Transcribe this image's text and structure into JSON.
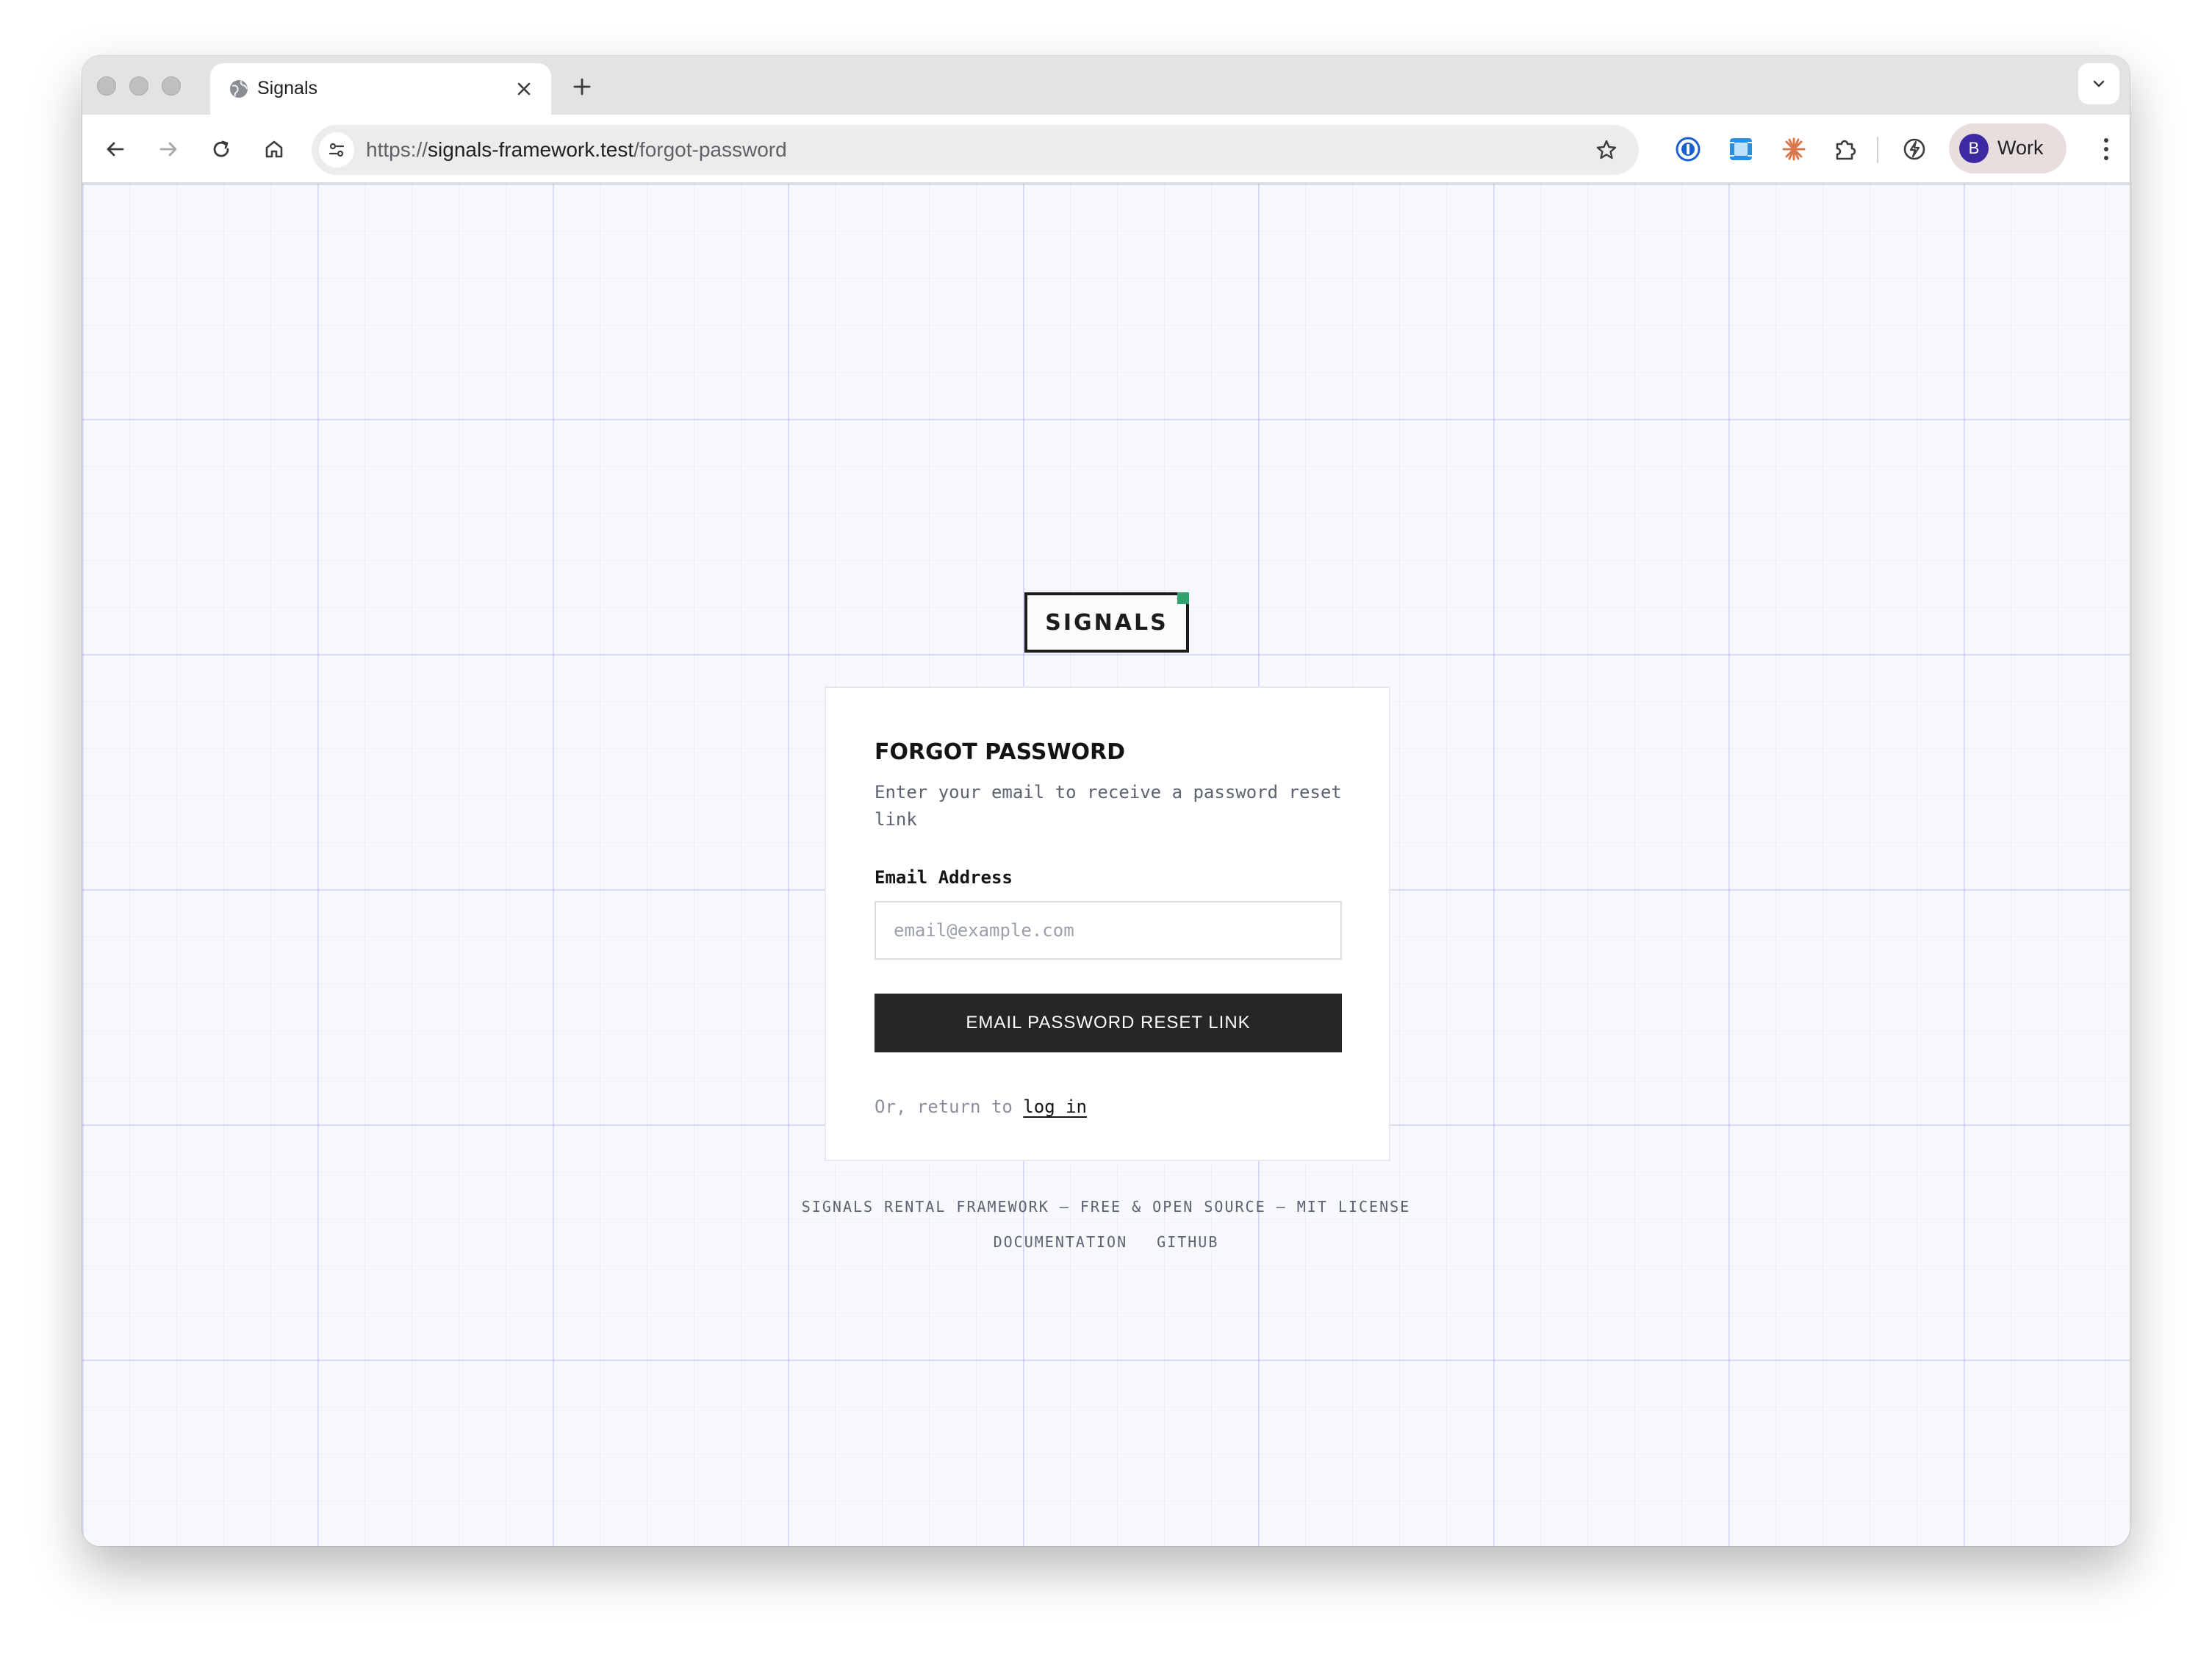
{
  "browser": {
    "tab_title": "Signals",
    "url_prefix": "https://",
    "url_host": "signals-framework.test",
    "url_path": "/forgot-password",
    "profile_initial": "B",
    "profile_name": "Work",
    "extensions": [
      "1password-icon",
      "frame-extension-icon",
      "claude-icon",
      "puzzle-icon"
    ],
    "accent_avatar": "#3d2aa3"
  },
  "page": {
    "logo_text": "SIGNALS",
    "logo_accent": "#2fa36b",
    "card": {
      "title": "FORGOT PASSWORD",
      "subtitle": "Enter your email to receive a password reset link",
      "email_label": "Email Address",
      "email_placeholder": "email@example.com",
      "email_value": "",
      "submit_label": "EMAIL PASSWORD RESET LINK",
      "return_prefix": "Or, return to",
      "return_link": "log in"
    },
    "footer": {
      "tagline": "SIGNALS RENTAL FRAMEWORK — FREE & OPEN SOURCE — MIT LICENSE",
      "links": [
        "DOCUMENTATION",
        "GITHUB"
      ]
    }
  }
}
